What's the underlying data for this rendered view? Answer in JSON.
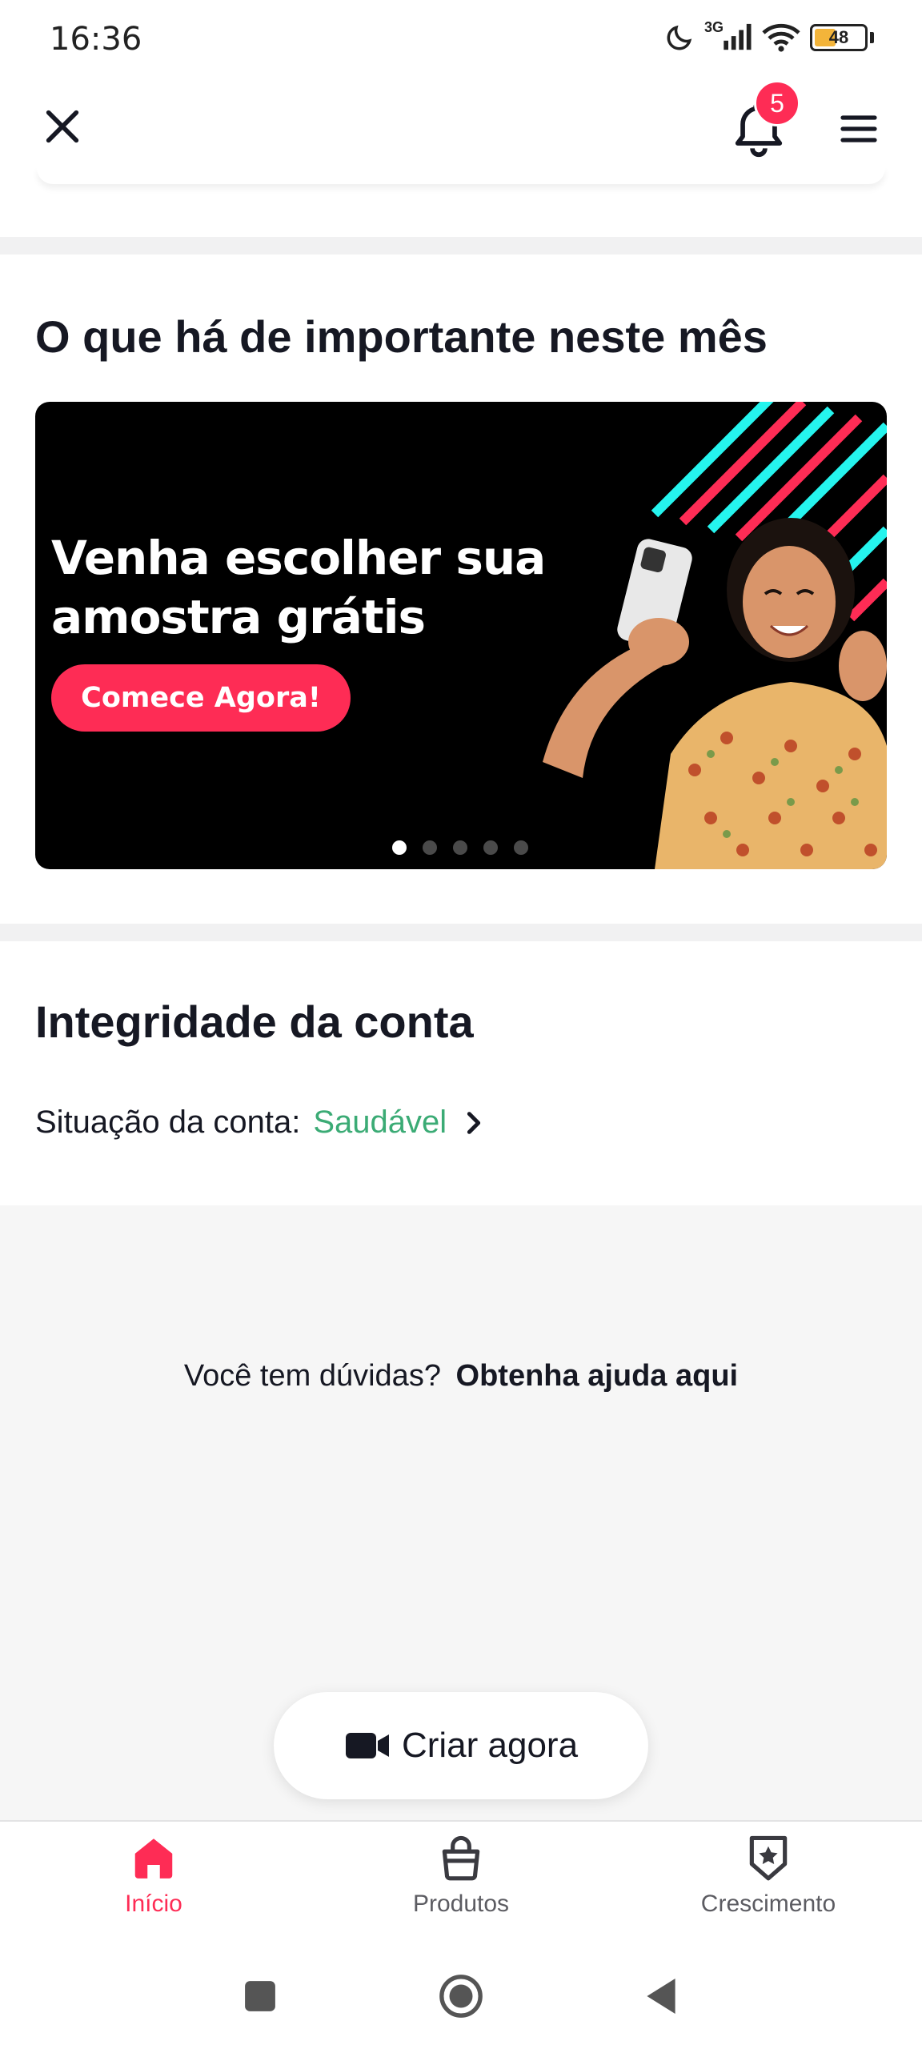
{
  "status_bar": {
    "time": "16:36",
    "network": "3G",
    "battery": "48",
    "battery_level": 0.48,
    "icons": [
      "moon-icon",
      "signal-icon",
      "wifi-icon",
      "battery-icon"
    ]
  },
  "top_nav": {
    "notification_count": "5",
    "icons": [
      "close-icon",
      "bell-icon",
      "menu-icon"
    ]
  },
  "highlights": {
    "title": "O que há de importante neste mês",
    "banner": {
      "headline": "Venha escolher sua amostra grátis",
      "cta": "Comece Agora!",
      "slide_count": 5,
      "active_slide": 1
    }
  },
  "integrity": {
    "title": "Integridade da conta",
    "status_label": "Situação da conta:",
    "status_value": "Saudável"
  },
  "help": {
    "question": "Você tem dúvidas?",
    "link": "Obtenha ajuda aqui"
  },
  "create_button": {
    "label": "Criar agora"
  },
  "bottom_nav": {
    "items": [
      {
        "label": "Início",
        "icon": "home-icon",
        "active": true
      },
      {
        "label": "Produtos",
        "icon": "shopping-bag-icon",
        "active": false
      },
      {
        "label": "Crescimento",
        "icon": "star-badge-icon",
        "active": false
      }
    ]
  },
  "colors": {
    "accent": "#fe2c55",
    "healthy": "#3bab75",
    "banner_bg": "#000000"
  }
}
